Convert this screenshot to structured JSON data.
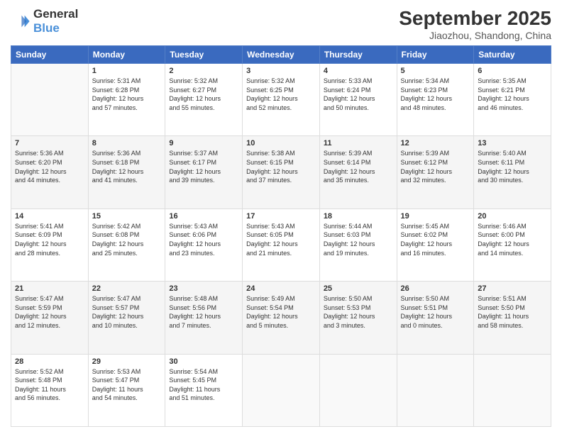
{
  "logo": {
    "line1": "General",
    "line2": "Blue"
  },
  "title": "September 2025",
  "location": "Jiaozhou, Shandong, China",
  "weekdays": [
    "Sunday",
    "Monday",
    "Tuesday",
    "Wednesday",
    "Thursday",
    "Friday",
    "Saturday"
  ],
  "weeks": [
    [
      {
        "day": "",
        "info": ""
      },
      {
        "day": "1",
        "info": "Sunrise: 5:31 AM\nSunset: 6:28 PM\nDaylight: 12 hours\nand 57 minutes."
      },
      {
        "day": "2",
        "info": "Sunrise: 5:32 AM\nSunset: 6:27 PM\nDaylight: 12 hours\nand 55 minutes."
      },
      {
        "day": "3",
        "info": "Sunrise: 5:32 AM\nSunset: 6:25 PM\nDaylight: 12 hours\nand 52 minutes."
      },
      {
        "day": "4",
        "info": "Sunrise: 5:33 AM\nSunset: 6:24 PM\nDaylight: 12 hours\nand 50 minutes."
      },
      {
        "day": "5",
        "info": "Sunrise: 5:34 AM\nSunset: 6:23 PM\nDaylight: 12 hours\nand 48 minutes."
      },
      {
        "day": "6",
        "info": "Sunrise: 5:35 AM\nSunset: 6:21 PM\nDaylight: 12 hours\nand 46 minutes."
      }
    ],
    [
      {
        "day": "7",
        "info": "Sunrise: 5:36 AM\nSunset: 6:20 PM\nDaylight: 12 hours\nand 44 minutes."
      },
      {
        "day": "8",
        "info": "Sunrise: 5:36 AM\nSunset: 6:18 PM\nDaylight: 12 hours\nand 41 minutes."
      },
      {
        "day": "9",
        "info": "Sunrise: 5:37 AM\nSunset: 6:17 PM\nDaylight: 12 hours\nand 39 minutes."
      },
      {
        "day": "10",
        "info": "Sunrise: 5:38 AM\nSunset: 6:15 PM\nDaylight: 12 hours\nand 37 minutes."
      },
      {
        "day": "11",
        "info": "Sunrise: 5:39 AM\nSunset: 6:14 PM\nDaylight: 12 hours\nand 35 minutes."
      },
      {
        "day": "12",
        "info": "Sunrise: 5:39 AM\nSunset: 6:12 PM\nDaylight: 12 hours\nand 32 minutes."
      },
      {
        "day": "13",
        "info": "Sunrise: 5:40 AM\nSunset: 6:11 PM\nDaylight: 12 hours\nand 30 minutes."
      }
    ],
    [
      {
        "day": "14",
        "info": "Sunrise: 5:41 AM\nSunset: 6:09 PM\nDaylight: 12 hours\nand 28 minutes."
      },
      {
        "day": "15",
        "info": "Sunrise: 5:42 AM\nSunset: 6:08 PM\nDaylight: 12 hours\nand 25 minutes."
      },
      {
        "day": "16",
        "info": "Sunrise: 5:43 AM\nSunset: 6:06 PM\nDaylight: 12 hours\nand 23 minutes."
      },
      {
        "day": "17",
        "info": "Sunrise: 5:43 AM\nSunset: 6:05 PM\nDaylight: 12 hours\nand 21 minutes."
      },
      {
        "day": "18",
        "info": "Sunrise: 5:44 AM\nSunset: 6:03 PM\nDaylight: 12 hours\nand 19 minutes."
      },
      {
        "day": "19",
        "info": "Sunrise: 5:45 AM\nSunset: 6:02 PM\nDaylight: 12 hours\nand 16 minutes."
      },
      {
        "day": "20",
        "info": "Sunrise: 5:46 AM\nSunset: 6:00 PM\nDaylight: 12 hours\nand 14 minutes."
      }
    ],
    [
      {
        "day": "21",
        "info": "Sunrise: 5:47 AM\nSunset: 5:59 PM\nDaylight: 12 hours\nand 12 minutes."
      },
      {
        "day": "22",
        "info": "Sunrise: 5:47 AM\nSunset: 5:57 PM\nDaylight: 12 hours\nand 10 minutes."
      },
      {
        "day": "23",
        "info": "Sunrise: 5:48 AM\nSunset: 5:56 PM\nDaylight: 12 hours\nand 7 minutes."
      },
      {
        "day": "24",
        "info": "Sunrise: 5:49 AM\nSunset: 5:54 PM\nDaylight: 12 hours\nand 5 minutes."
      },
      {
        "day": "25",
        "info": "Sunrise: 5:50 AM\nSunset: 5:53 PM\nDaylight: 12 hours\nand 3 minutes."
      },
      {
        "day": "26",
        "info": "Sunrise: 5:50 AM\nSunset: 5:51 PM\nDaylight: 12 hours\nand 0 minutes."
      },
      {
        "day": "27",
        "info": "Sunrise: 5:51 AM\nSunset: 5:50 PM\nDaylight: 11 hours\nand 58 minutes."
      }
    ],
    [
      {
        "day": "28",
        "info": "Sunrise: 5:52 AM\nSunset: 5:48 PM\nDaylight: 11 hours\nand 56 minutes."
      },
      {
        "day": "29",
        "info": "Sunrise: 5:53 AM\nSunset: 5:47 PM\nDaylight: 11 hours\nand 54 minutes."
      },
      {
        "day": "30",
        "info": "Sunrise: 5:54 AM\nSunset: 5:45 PM\nDaylight: 11 hours\nand 51 minutes."
      },
      {
        "day": "",
        "info": ""
      },
      {
        "day": "",
        "info": ""
      },
      {
        "day": "",
        "info": ""
      },
      {
        "day": "",
        "info": ""
      }
    ]
  ]
}
